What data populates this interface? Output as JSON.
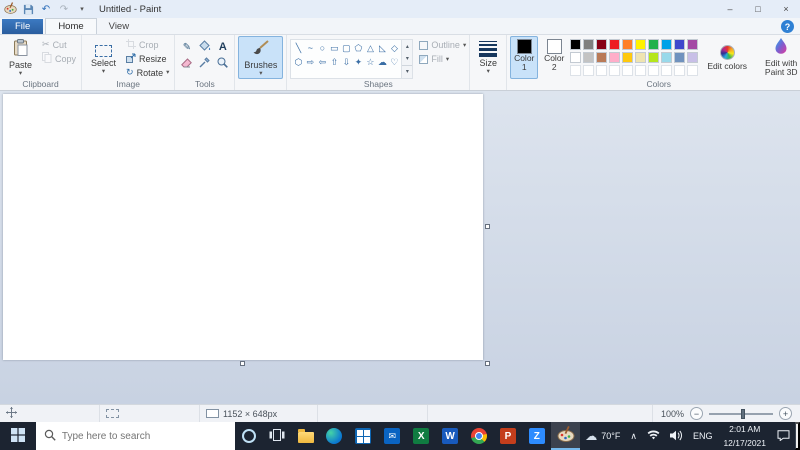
{
  "titlebar": {
    "title": "Untitled - Paint"
  },
  "tabs": {
    "file": "File",
    "home": "Home",
    "view": "View"
  },
  "glyphs": {
    "dropdown": "▾",
    "scroll_up": "▴",
    "scroll_down": "▾",
    "undo": "↶",
    "redo": "↷",
    "rotate": "↻",
    "pencil": "✎",
    "scissors": "✂",
    "text_tool": "A",
    "help": "?",
    "minimize": "–",
    "maximize": "□",
    "close": "×",
    "cloud": "☁",
    "chevron_up": "∧",
    "zoom_minus": "−",
    "zoom_plus": "+",
    "envelope": "✉"
  },
  "ribbon": {
    "clipboard": {
      "label": "Clipboard",
      "paste": "Paste",
      "cut": "Cut",
      "copy": "Copy"
    },
    "image": {
      "label": "Image",
      "select": "Select",
      "crop": "Crop",
      "resize": "Resize",
      "rotate": "Rotate"
    },
    "tools": {
      "label": "Tools"
    },
    "brushes": {
      "button": "Brushes"
    },
    "shapes": {
      "label": "Shapes",
      "outline": "Outline",
      "fill": "Fill",
      "items": [
        "╲",
        "~",
        "○",
        "▭",
        "▢",
        "⬠",
        "△",
        "◺",
        "◇",
        "⬡",
        "⇨",
        "⇦",
        "⇧",
        "⇩",
        "✦",
        "☆",
        "☁",
        "♡"
      ]
    },
    "size": {
      "button": "Size"
    },
    "colors": {
      "label": "Colors",
      "color1_label": "Color 1",
      "color2_label": "Color 2",
      "color1": "#000000",
      "color2": "#FFFFFF",
      "edit_colors": "Edit colors",
      "edit_3d": "Edit with Paint 3D",
      "palette": [
        "#000000",
        "#7F7F7F",
        "#880015",
        "#ED1C24",
        "#FF7F27",
        "#FFF200",
        "#22B14C",
        "#00A2E8",
        "#3F48CC",
        "#A349A4",
        "#FFFFFF",
        "#C3C3C3",
        "#B97A57",
        "#FFAEC9",
        "#FFC90E",
        "#EFE4B0",
        "#B5E61D",
        "#99D9EA",
        "#7092BE",
        "#C8BFE7"
      ]
    }
  },
  "statusbar": {
    "canvas_size": "1152 × 648px",
    "zoom_level": "100%"
  },
  "taskbar": {
    "search_placeholder": "Type here to search",
    "app_letters": {
      "excel": "X",
      "word": "W",
      "powerpoint": "P",
      "zoom": "Z"
    },
    "tray": {
      "temperature": "70°F",
      "language": "ENG",
      "time": "2:01 AM",
      "date": "12/17/2021"
    }
  }
}
